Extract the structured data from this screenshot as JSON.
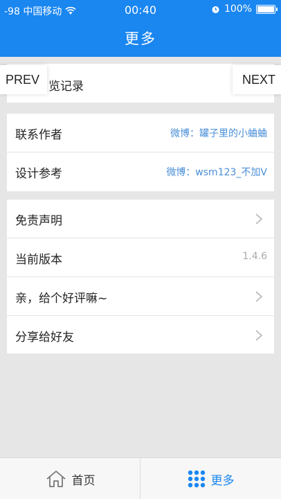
{
  "status_bar": {
    "carrier": "-98 中国移动",
    "time": "00:40",
    "battery": "100%",
    "battery_level": 1.0
  },
  "header": {
    "title": "更多"
  },
  "history": {
    "label": "浏览记录",
    "partial_text": "览记录"
  },
  "overlay": {
    "prev": "PREV",
    "next": "NEXT"
  },
  "section_contact": [
    {
      "label": "联系作者",
      "value": "微博：罐子里的小蛐蛐"
    },
    {
      "label": "设计参考",
      "value": "微博：wsm123_不加V"
    }
  ],
  "section_misc": [
    {
      "label": "免责声明",
      "arrow": true
    },
    {
      "label": "当前版本",
      "value": "1.4.6"
    },
    {
      "label": "亲，给个好评嘛~",
      "arrow": true
    },
    {
      "label": "分享给好友",
      "arrow": true
    }
  ],
  "tabbar": {
    "home_label": "首页",
    "more_label": "更多",
    "active": "more",
    "active_color": "#1a86f0"
  }
}
